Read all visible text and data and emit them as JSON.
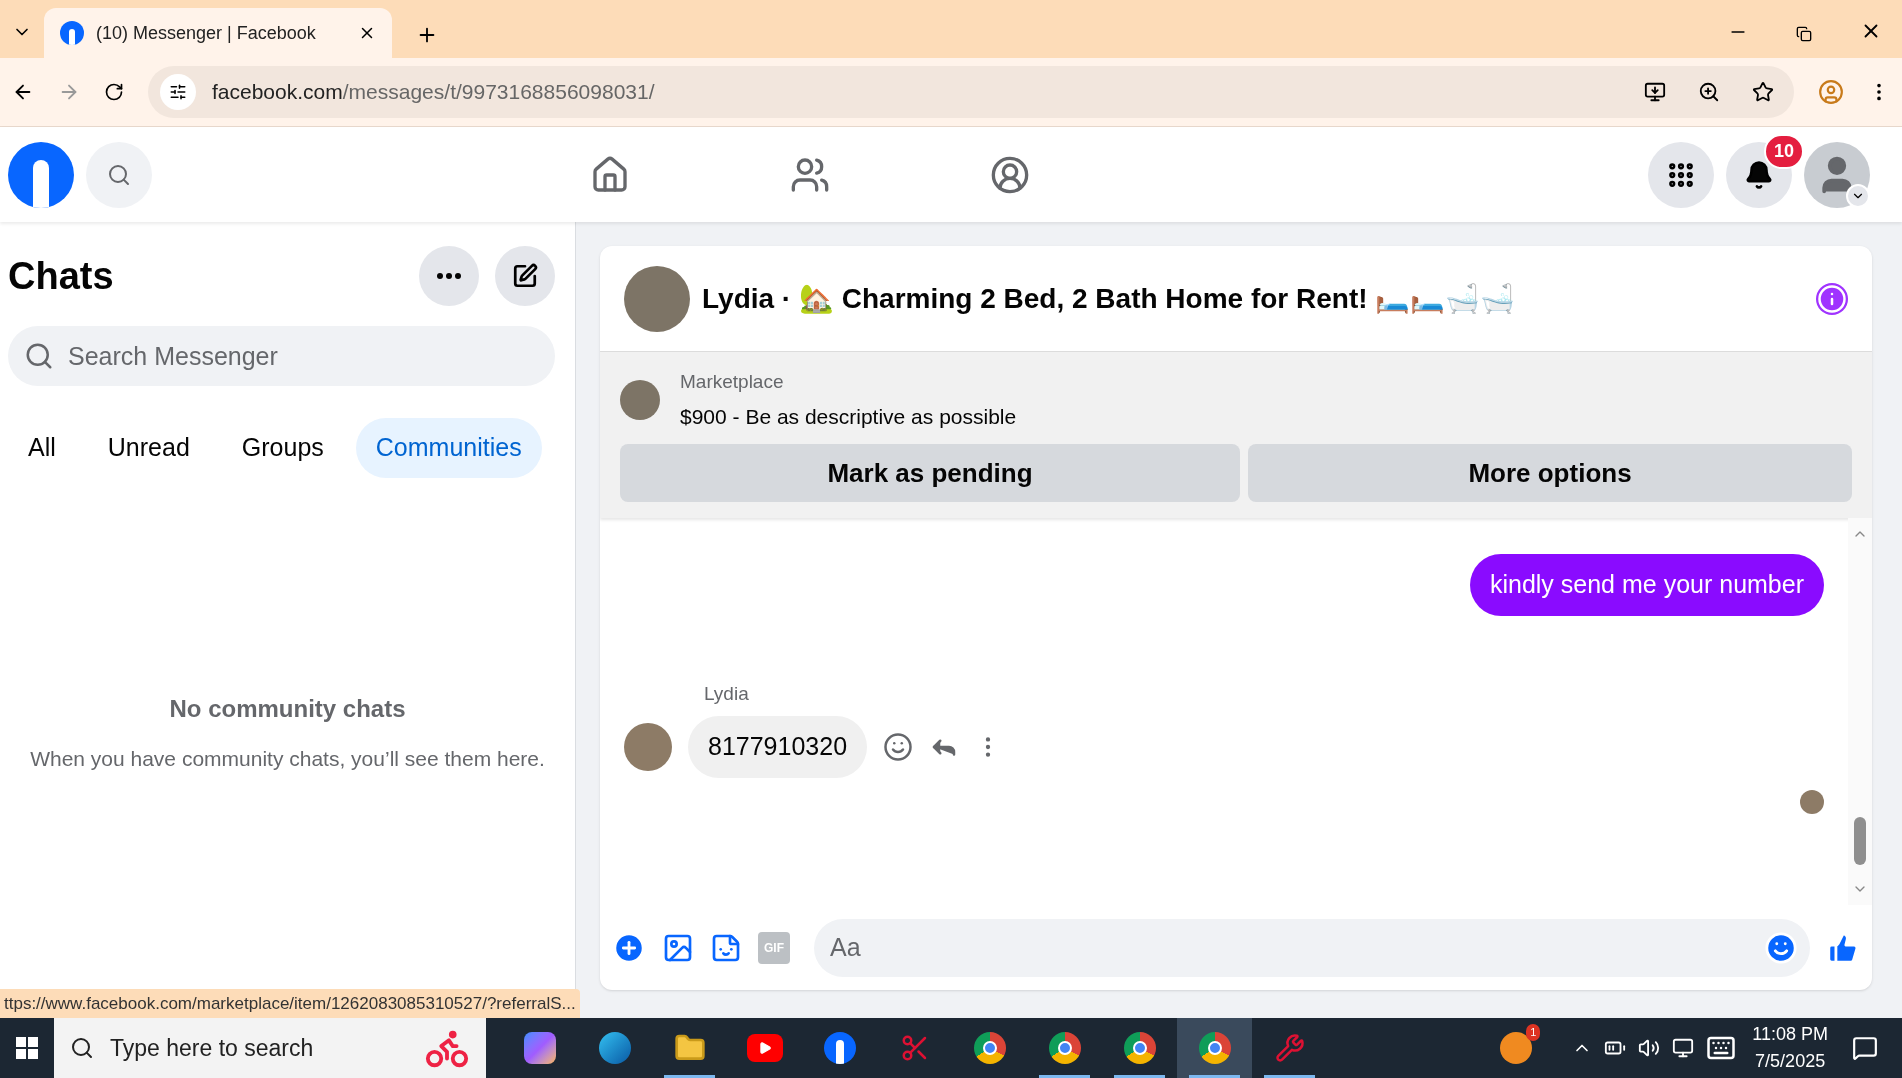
{
  "browser": {
    "tab_title": "(10) Messenger | Facebook",
    "url_domain": "facebook.com",
    "url_path": "/messages/t/9973168856098031/",
    "status_url": "ttps://www.facebook.com/marketplace/item/1262083085310527/?referralS..."
  },
  "header": {
    "notification_count": "10"
  },
  "chats": {
    "title": "Chats",
    "search": {
      "placeholder": "Search Messenger"
    },
    "filters": [
      {
        "label": "All",
        "selected": false
      },
      {
        "label": "Unread",
        "selected": false
      },
      {
        "label": "Groups",
        "selected": false
      },
      {
        "label": "Communities",
        "selected": true
      }
    ],
    "empty_title": "No community chats",
    "empty_text": "When you have community chats, you’ll see them here."
  },
  "conversation": {
    "title": "Lydia · 🏡 Charming 2 Bed, 2 Bath Home for Rent! 🛏️🛏️🛁🛁",
    "listing": {
      "source": "Marketplace",
      "text": "$900 - Be as descriptive as possible",
      "buttons": [
        "Mark as pending",
        "More options"
      ]
    },
    "messages": [
      {
        "kind": "sent",
        "text": "kindly send me your number"
      },
      {
        "kind": "received",
        "sender": "Lydia",
        "text": "8177910320"
      }
    ],
    "composer": {
      "gif_label": "GIF",
      "placeholder": "Aa"
    }
  },
  "taskbar": {
    "search_placeholder": "Type here to search",
    "tray_badge": "1",
    "time": "11:08 PM",
    "date": "7/5/2025",
    "apps": [
      {
        "kind": "copilot",
        "selected": false,
        "running": false
      },
      {
        "kind": "edge",
        "selected": false,
        "running": false
      },
      {
        "kind": "files",
        "selected": false,
        "running": true
      },
      {
        "kind": "youtube",
        "selected": false,
        "running": false
      },
      {
        "kind": "facebook",
        "selected": false,
        "running": false
      },
      {
        "kind": "snip",
        "selected": false,
        "running": false
      },
      {
        "kind": "chrome",
        "selected": false,
        "running": false
      },
      {
        "kind": "chrome",
        "selected": false,
        "running": true
      },
      {
        "kind": "chrome",
        "selected": false,
        "running": true
      },
      {
        "kind": "chrome",
        "selected": true,
        "running": true
      },
      {
        "kind": "tool",
        "selected": false,
        "running": true
      }
    ]
  }
}
